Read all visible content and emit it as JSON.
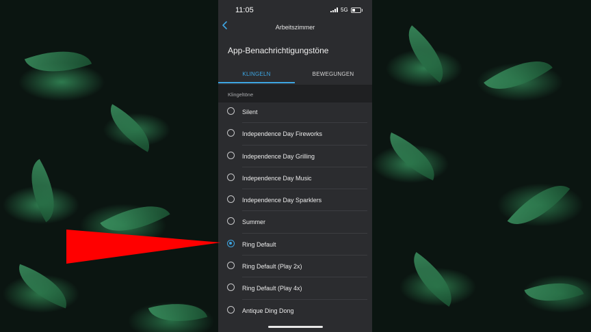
{
  "status": {
    "time": "11:05",
    "network": "5G"
  },
  "nav": {
    "title": "Arbeitszimmer"
  },
  "page": {
    "heading": "App-Benachrichtigungstöne"
  },
  "tabs": [
    {
      "label": "KLINGELN",
      "active": true
    },
    {
      "label": "BEWEGUNGEN",
      "active": false
    }
  ],
  "section": {
    "label": "Klingeltöne"
  },
  "ringtones": [
    {
      "label": "Silent",
      "selected": false
    },
    {
      "label": "Independence Day Fireworks",
      "selected": false
    },
    {
      "label": "Independence Day Grilling",
      "selected": false
    },
    {
      "label": "Independence Day Music",
      "selected": false
    },
    {
      "label": "Independence Day Sparklers",
      "selected": false
    },
    {
      "label": "Summer",
      "selected": false
    },
    {
      "label": "Ring Default",
      "selected": true
    },
    {
      "label": "Ring Default (Play 2x)",
      "selected": false
    },
    {
      "label": "Ring Default (Play 4x)",
      "selected": false
    },
    {
      "label": "Antique Ding Dong",
      "selected": false
    }
  ],
  "icons": {
    "back": "chevron-left-icon",
    "signal": "signal-bars-icon",
    "battery": "battery-icon",
    "pointer": "red-arrow-annotation"
  },
  "colors": {
    "accent": "#3ea6e3",
    "panel": "#2b2c2f",
    "section_bg": "#1f2022",
    "annotation": "#ff0000"
  }
}
